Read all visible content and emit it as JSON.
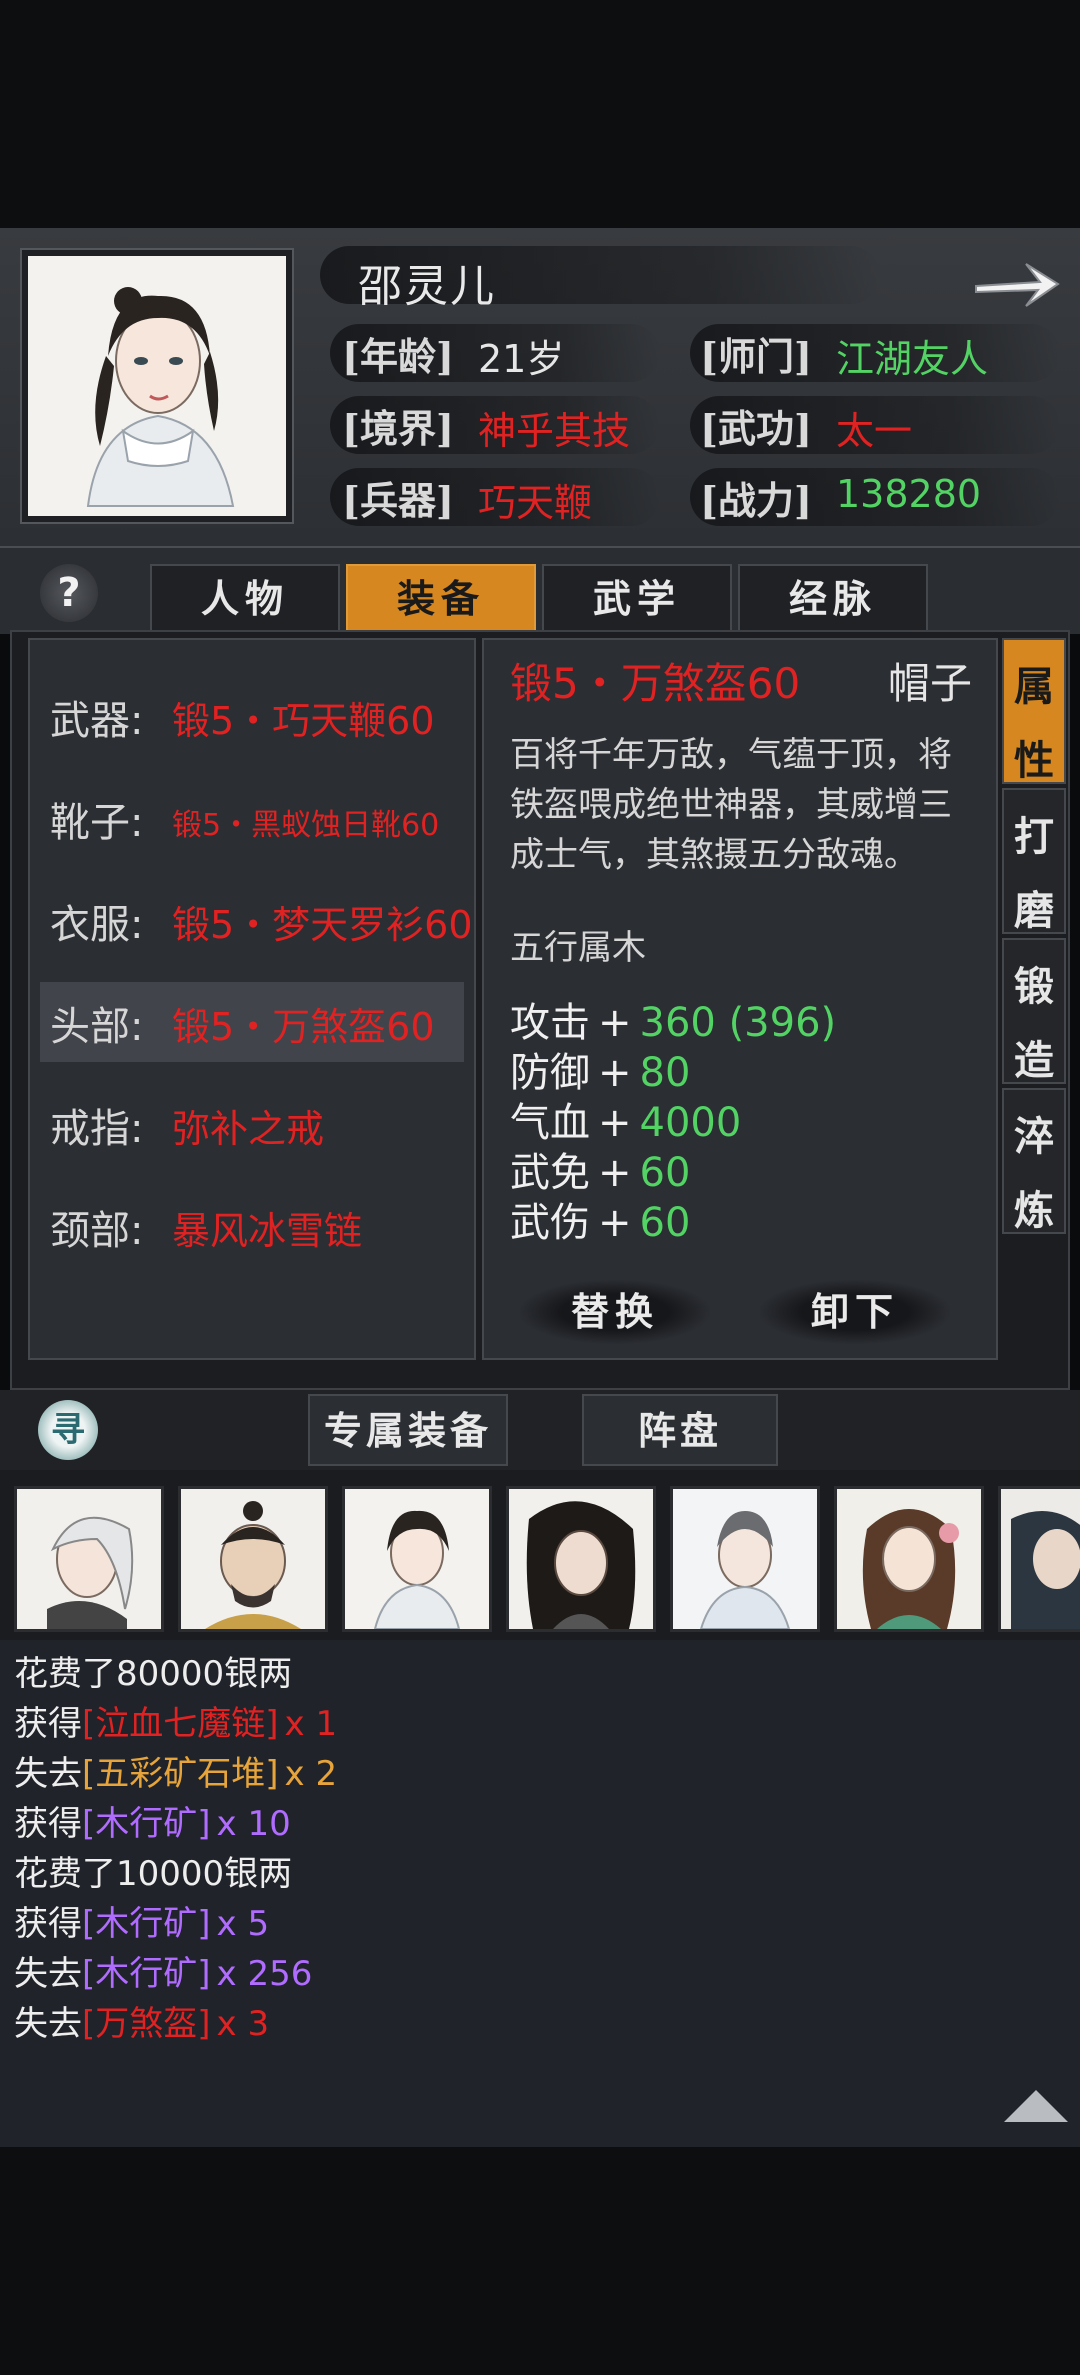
{
  "colors": {
    "accent": "#d6871f",
    "red": "#e02222",
    "green": "#52d364",
    "purple": "#b06cff",
    "orange": "#e6a43a"
  },
  "hero": {
    "name": "邵灵儿",
    "stats": [
      {
        "label": "[年龄]",
        "value": "21岁",
        "color": "#e6e6e6"
      },
      {
        "label": "[师门]",
        "value": "江湖友人",
        "color": "#52d364"
      },
      {
        "label": "[境界]",
        "value": "神乎其技",
        "color": "#e02222"
      },
      {
        "label": "[武功]",
        "value": "太一",
        "color": "#e02222"
      },
      {
        "label": "[兵器]",
        "value": "巧天鞭",
        "color": "#e02222"
      },
      {
        "label": "[战力]",
        "value": "138280",
        "color": "#52d364"
      }
    ]
  },
  "tabs": [
    {
      "label": "人物",
      "active": false
    },
    {
      "label": "装备",
      "active": true
    },
    {
      "label": "武学",
      "active": false
    },
    {
      "label": "经脉",
      "active": false
    }
  ],
  "help_label": "?",
  "slots": [
    {
      "label": "武器:",
      "value": "锻5・巧天鞭60",
      "small": false,
      "selected": false
    },
    {
      "label": "靴子:",
      "value": "锻5・黑蚁蚀日靴60",
      "small": true,
      "selected": false
    },
    {
      "label": "衣服:",
      "value": "锻5・梦天罗衫60",
      "small": false,
      "selected": false
    },
    {
      "label": "头部:",
      "value": "锻5・万煞盔60",
      "small": false,
      "selected": true
    },
    {
      "label": "戒指:",
      "value": "弥补之戒",
      "small": false,
      "selected": false
    },
    {
      "label": "颈部:",
      "value": "暴风冰雪链",
      "small": false,
      "selected": false
    }
  ],
  "detail": {
    "title": "锻5・万煞盔60",
    "type": "帽子",
    "desc": "百将千年万敌，气蕴于顶，将铁盔喂成绝世神器，其威增三成士气，其煞摄五分敌魂。",
    "element": "五行属木",
    "attributes": [
      {
        "name": "攻击",
        "plus": "+",
        "value": "360 (396)"
      },
      {
        "name": "防御",
        "plus": "+",
        "value": "80"
      },
      {
        "name": "气血",
        "plus": "+",
        "value": "4000"
      },
      {
        "name": "武免",
        "plus": "+",
        "value": "60"
      },
      {
        "name": "武伤",
        "plus": "+",
        "value": "60"
      }
    ],
    "replace_label": "替换",
    "unequip_label": "卸下"
  },
  "side_tabs": [
    {
      "label": "属性",
      "c1": "属",
      "c2": "性",
      "active": true
    },
    {
      "label": "打磨",
      "c1": "打",
      "c2": "磨",
      "active": false
    },
    {
      "label": "锻造",
      "c1": "锻",
      "c2": "造",
      "active": false
    },
    {
      "label": "淬炼",
      "c1": "淬",
      "c2": "炼",
      "active": false
    }
  ],
  "search_label": "寻",
  "sub_tabs": [
    {
      "label": "专属装备"
    },
    {
      "label": "阵盘"
    }
  ],
  "log": [
    {
      "prefix": "花费了80000银两",
      "item": "",
      "qty": "",
      "color": ""
    },
    {
      "prefix": "获得",
      "item": "[泣血七魔链]",
      "qty": "x 1",
      "color": "#e02222"
    },
    {
      "prefix": "失去",
      "item": "[五彩矿石堆]",
      "qty": "x 2",
      "color": "#e6a43a"
    },
    {
      "prefix": "获得",
      "item": "[木行矿]",
      "qty": "x 10",
      "color": "#b06cff"
    },
    {
      "prefix": "花费了10000银两",
      "item": "",
      "qty": "",
      "color": ""
    },
    {
      "prefix": "获得",
      "item": "[木行矿]",
      "qty": "x 5",
      "color": "#b06cff"
    },
    {
      "prefix": "失去",
      "item": "[木行矿]",
      "qty": "x 256",
      "color": "#b06cff"
    },
    {
      "prefix": "失去",
      "item": "[万煞盔]",
      "qty": "x 3",
      "color": "#e02222"
    }
  ]
}
